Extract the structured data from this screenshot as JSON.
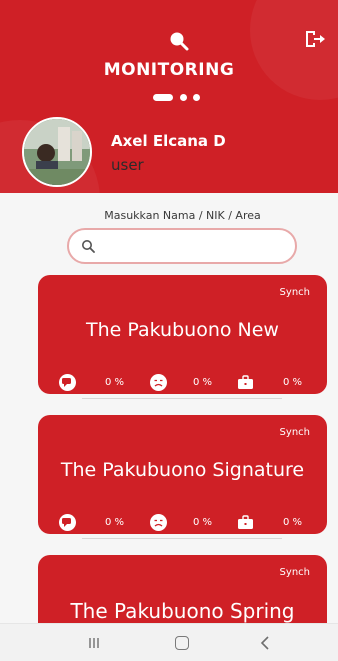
{
  "header": {
    "title": "MONITORING",
    "search_icon": "search-icon",
    "logout_icon": "logout-icon",
    "bg_color": "#cf2026"
  },
  "profile": {
    "name": "Axel Elcana D",
    "role": "user"
  },
  "search": {
    "label": "Masukkan Nama / NIK / Area",
    "value": "",
    "placeholder": ""
  },
  "projects": [
    {
      "sync_label": "Synch",
      "name": "The Pakubuono New",
      "stats": [
        {
          "icon": "speech-bubble-icon",
          "value": "0 %"
        },
        {
          "icon": "sad-face-icon",
          "value": "0 %"
        },
        {
          "icon": "briefcase-icon",
          "value": "0 %"
        }
      ]
    },
    {
      "sync_label": "Synch",
      "name": "The Pakubuono Signature",
      "stats": [
        {
          "icon": "speech-bubble-icon",
          "value": "0 %"
        },
        {
          "icon": "sad-face-icon",
          "value": "0 %"
        },
        {
          "icon": "briefcase-icon",
          "value": "0 %"
        }
      ]
    },
    {
      "sync_label": "Synch",
      "name": "The Pakubuono Spring",
      "stats": []
    }
  ],
  "navbar": {
    "recents_icon": "recents-icon",
    "home_icon": "home-icon",
    "back_icon": "back-icon"
  }
}
